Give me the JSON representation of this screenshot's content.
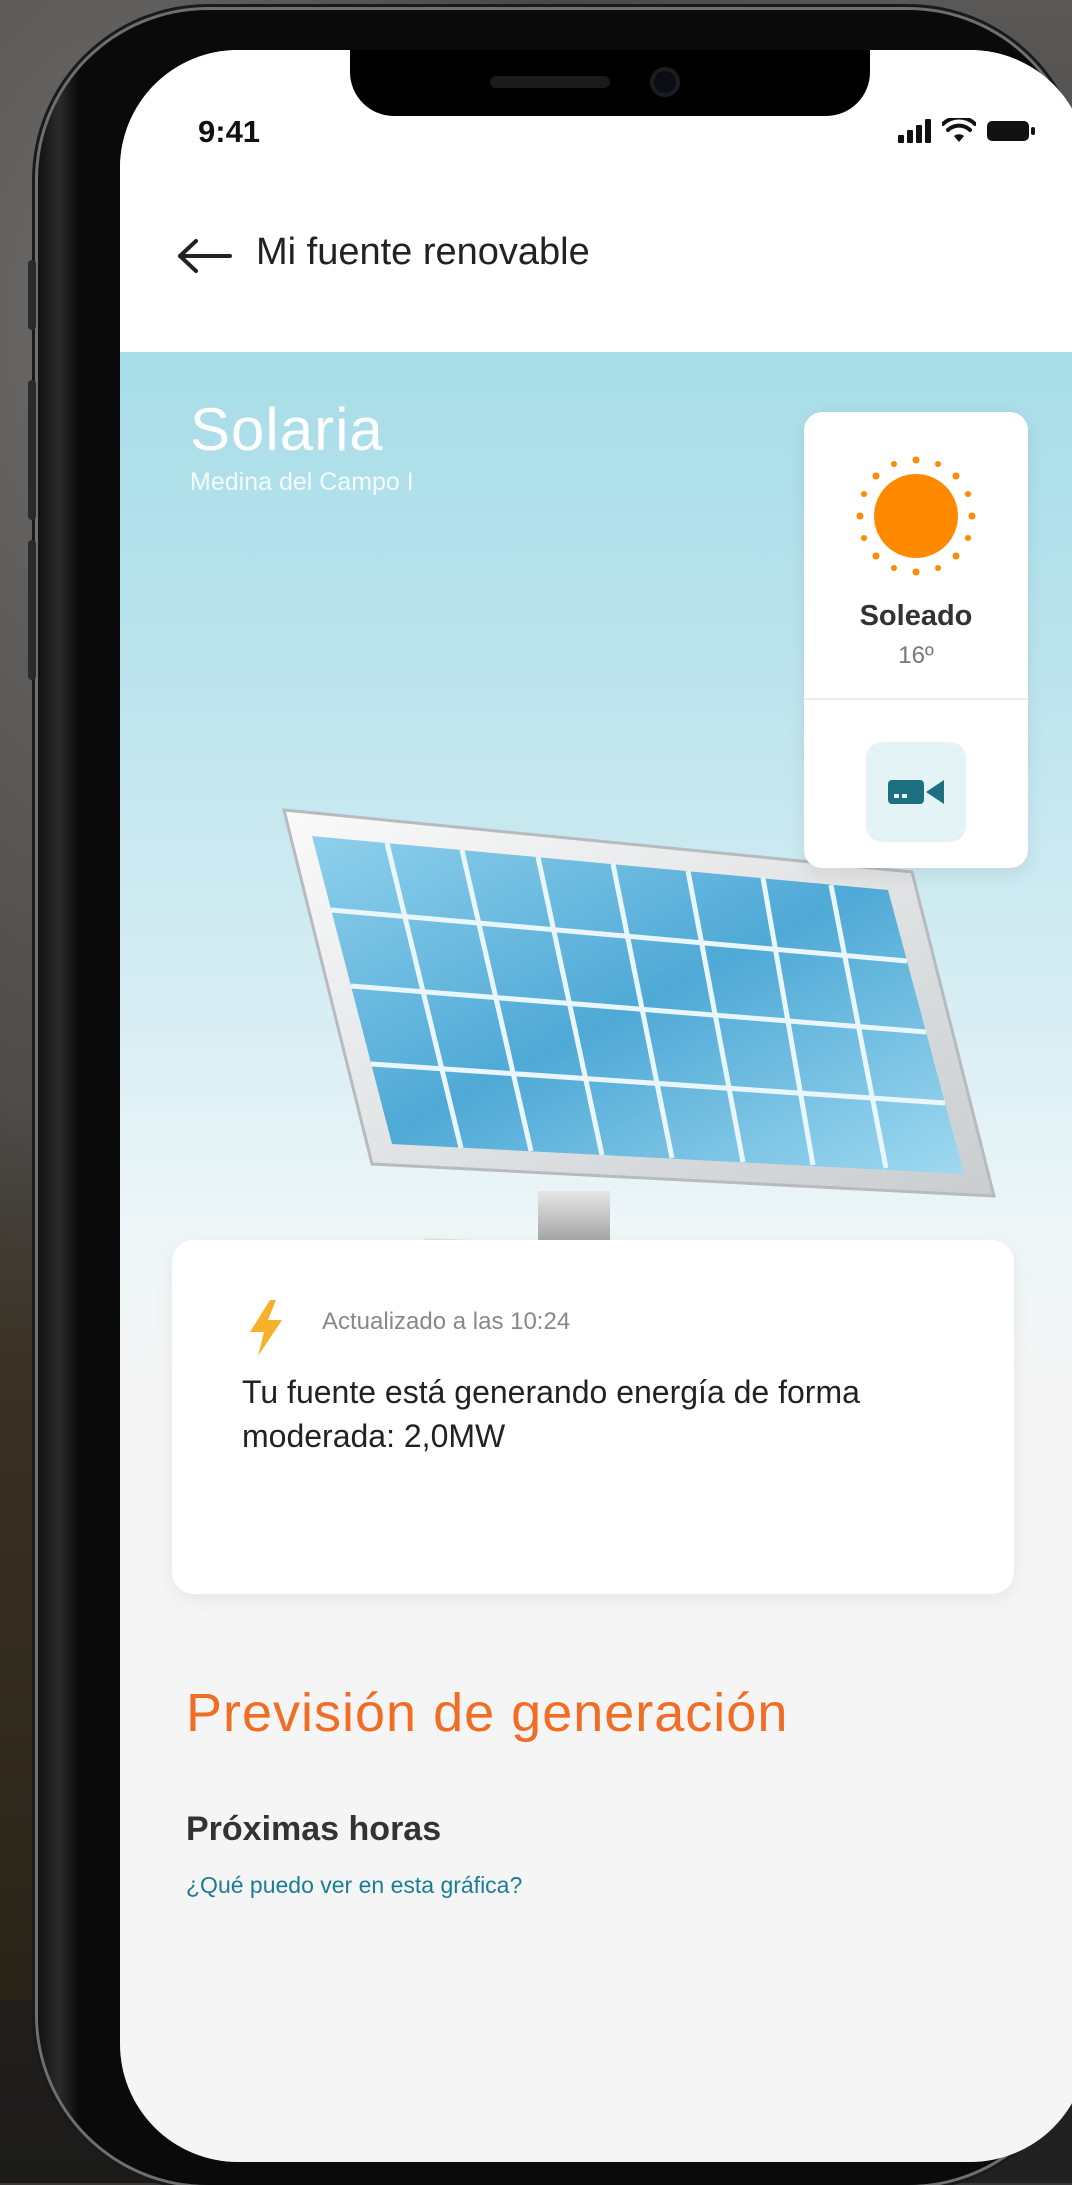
{
  "status_bar": {
    "time": "9:41"
  },
  "appbar": {
    "title": "Mi fuente renovable"
  },
  "plant": {
    "name": "Solaria",
    "location": "Medina del Campo I"
  },
  "weather": {
    "condition": "Soleado",
    "temperature": "16º",
    "icon": "sun-icon",
    "camera_icon": "video-camera-icon"
  },
  "generation_card": {
    "updated_label": "Actualizado a las 10:24",
    "message": "Tu fuente está generando energía de forma moderada: 2,0MW",
    "icon": "lightning-bolt-icon"
  },
  "forecast": {
    "title": "Previsión de generación",
    "subtitle": "Próximas horas",
    "help_link": "¿Qué puedo ver en esta gráfica?"
  },
  "colors": {
    "accent_orange": "#f16d24",
    "sun_orange": "#ff8a00",
    "camera_teal": "#1d6f82",
    "link_teal": "#1a7d94",
    "sky_top": "#a7dde8"
  }
}
